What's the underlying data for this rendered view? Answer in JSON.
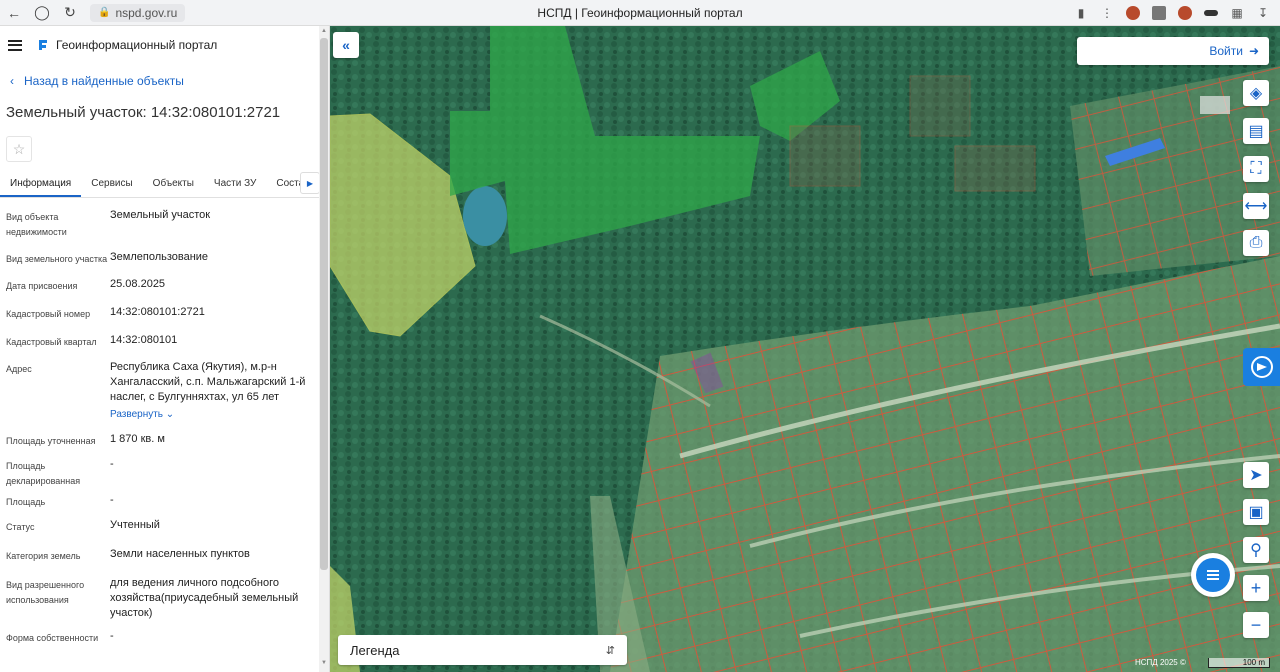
{
  "browser": {
    "url": "nspd.gov.ru",
    "tab_title": "НСПД | Геоинформационный портал"
  },
  "app": {
    "title": "Геоинформационный портал"
  },
  "panel": {
    "back_label": "Назад в найденные объекты",
    "object_title": "Земельный участок: 14:32:080101:2721",
    "tabs": [
      "Информация",
      "Сервисы",
      "Объекты",
      "Части ЗУ",
      "Соста"
    ],
    "expand_label": "Развернуть",
    "properties": [
      {
        "key": "Вид объекта недвижимости",
        "value": "Земельный участок"
      },
      {
        "key": "Вид земельного участка",
        "value": "Землепользование"
      },
      {
        "key": "Дата присвоения",
        "value": "25.08.2025"
      },
      {
        "key": "Кадастровый номер",
        "value": "14:32:080101:2721"
      },
      {
        "key": "Кадастровый квартал",
        "value": "14:32:080101"
      },
      {
        "key": "Адрес",
        "value": "Республика Саха (Якутия), м.р-н Хангаласский, с.п. Мальжагарский 1-й наслег, с Булгунняхтах, ул 65 лет"
      },
      {
        "key": "Площадь уточненная",
        "value": "1 870 кв. м"
      },
      {
        "key": "Площадь декларированная",
        "value": "-"
      },
      {
        "key": "Площадь",
        "value": "-"
      },
      {
        "key": "Статус",
        "value": "Учтенный"
      },
      {
        "key": "Категория земель",
        "value": "Земли населенных пунктов"
      },
      {
        "key": "Вид разрешенного использования",
        "value": "для ведения личного подсобного хозяйства(приусадебный земельный участок)"
      },
      {
        "key": "Форма собственности",
        "value": "-"
      }
    ]
  },
  "map": {
    "login_label": "Войти",
    "legend_label": "Легенда",
    "copyright": "НСПД 2025 ©",
    "scale_label": "100 m"
  },
  "colors": {
    "accent": "#1a64c6",
    "parcel_outline": "#d9553a",
    "selected_parcel": "#9b2fb5",
    "forest_zone": "#2fa84a",
    "field_zone": "#c8d96a"
  }
}
